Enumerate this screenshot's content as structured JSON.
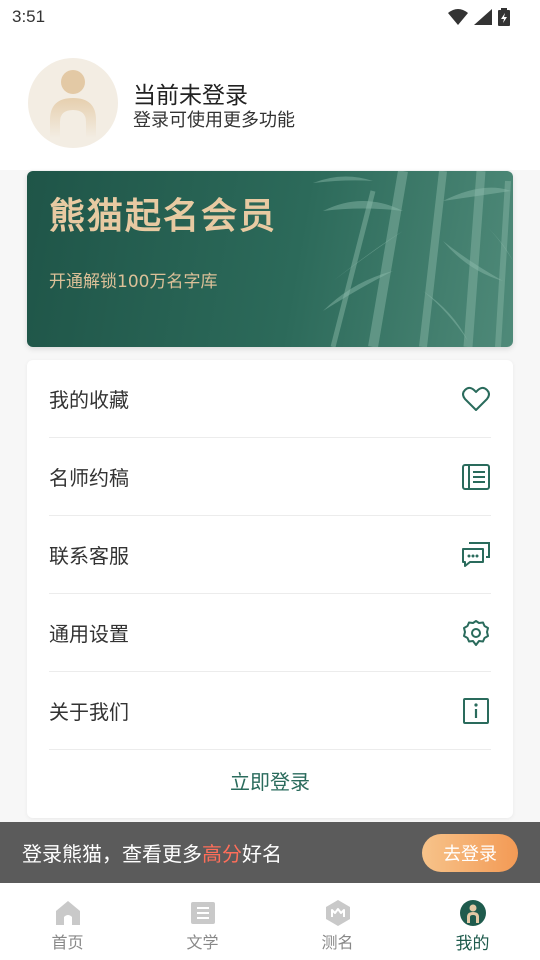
{
  "status_bar": {
    "time": "3:51"
  },
  "profile": {
    "title": "当前未登录",
    "subtitle": "登录可使用更多功能"
  },
  "banner": {
    "title": "熊猫起名会员",
    "subtitle": "开通解锁100万名字库"
  },
  "menu": {
    "items": [
      {
        "label": "我的收藏",
        "icon": "heart-icon"
      },
      {
        "label": "名师约稿",
        "icon": "document-icon"
      },
      {
        "label": "联系客服",
        "icon": "chat-icon"
      },
      {
        "label": "通用设置",
        "icon": "gear-icon"
      },
      {
        "label": "关于我们",
        "icon": "info-icon"
      }
    ],
    "login_link": "立即登录"
  },
  "login_bar": {
    "text_before": "登录熊猫，查看更多",
    "highlight": "高分",
    "text_after": "好名",
    "button": "去登录"
  },
  "tabbar": {
    "tabs": [
      {
        "label": "首页",
        "icon": "home-icon",
        "active": false
      },
      {
        "label": "文学",
        "icon": "book-icon",
        "active": false
      },
      {
        "label": "测名",
        "icon": "test-name-icon",
        "active": false
      },
      {
        "label": "我的",
        "icon": "profile-icon",
        "active": true
      }
    ]
  },
  "colors": {
    "accent": "#1f5b4d",
    "banner_gold": "#e8caa2",
    "highlight_red": "#ff6e5a",
    "button_orange": "#f39a55"
  }
}
